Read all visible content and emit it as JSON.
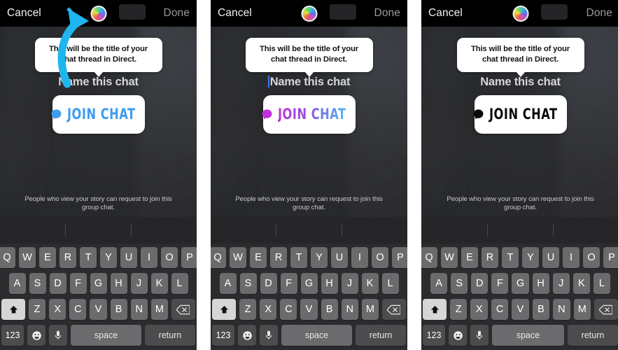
{
  "panels": [
    {
      "id": "panel-1",
      "topbar": {
        "cancel": "Cancel",
        "done": "Done",
        "color_wheel_icon": "color-wheel-icon"
      },
      "tooltip": "This will be the title of your chat thread in Direct.",
      "chat_title": "Name this chat",
      "join_button": {
        "label": "JOIN CHAT",
        "icon": "chat-bubble-icon",
        "style": "blue",
        "color": "#3d9bf0"
      },
      "footnote": "People who view your story can request to join this group chat.",
      "caret_visible": false,
      "annotation": {
        "type": "curved-arrow-icon",
        "color": "#1fb6ef",
        "points_to": "color-wheel-icon"
      }
    },
    {
      "id": "panel-2",
      "topbar": {
        "cancel": "Cancel",
        "done": "Done",
        "color_wheel_icon": "color-wheel-icon"
      },
      "tooltip": "This will be the title of your chat thread in Direct.",
      "chat_title": "Name this chat",
      "join_button": {
        "label": "JOIN CHAT",
        "icon": "chat-bubble-icon",
        "style": "grad",
        "color": "#c030d8"
      },
      "footnote": "People who view your story can request to join this group chat.",
      "caret_visible": true,
      "annotation": null
    },
    {
      "id": "panel-3",
      "topbar": {
        "cancel": "Cancel",
        "done": "Done",
        "color_wheel_icon": "color-wheel-icon"
      },
      "tooltip": "This will be the title of your chat thread in Direct.",
      "chat_title": "Name this chat",
      "join_button": {
        "label": "JOIN CHAT",
        "icon": "chat-bubble-icon",
        "style": "black",
        "color": "#0b0b0b"
      },
      "footnote": "People who view your story can request to join this group chat.",
      "caret_visible": false,
      "annotation": null
    }
  ],
  "keyboard": {
    "row1": [
      "Q",
      "W",
      "E",
      "R",
      "T",
      "Y",
      "U",
      "I",
      "O",
      "P"
    ],
    "row2": [
      "A",
      "S",
      "D",
      "F",
      "G",
      "H",
      "J",
      "K",
      "L"
    ],
    "row3": [
      "Z",
      "X",
      "C",
      "V",
      "B",
      "N",
      "M"
    ],
    "shift_icon": "shift-up-arrow-icon",
    "backspace_icon": "backspace-delete-icon",
    "numbers_key": "123",
    "emoji_icon": "emoji-smiley-icon",
    "mic_icon": "microphone-icon",
    "space_key": "space",
    "return_key": "return"
  },
  "colors": {
    "accent_blue": "#3d9bf0",
    "annotation_cyan": "#1fb6ef",
    "gradient_start": "#c030d8",
    "gradient_end": "#58b9f2",
    "black_variant": "#0b0b0b",
    "keyboard_bg": "#2c2c2e",
    "key_bg": "#6b6b6d",
    "topbar_bg": "#000000",
    "caret": "#3b7af0"
  }
}
